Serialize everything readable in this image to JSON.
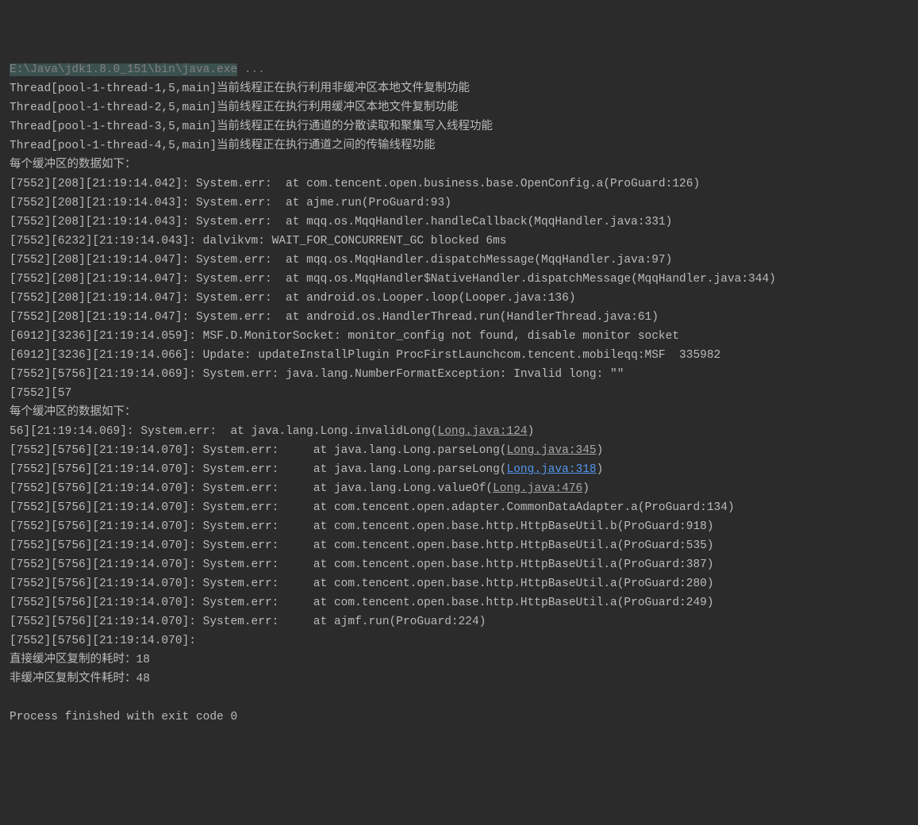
{
  "header": {
    "prefix": "E:\\Java\\jdk1.8.0_151\\bin\\java.exe",
    "suffix": " ..."
  },
  "threads": [
    {
      "prefix": "Thread[pool-1-thread-1,5,main]",
      "text": "当前线程正在执行利用非缓冲区本地文件复制功能"
    },
    {
      "prefix": "Thread[pool-1-thread-2,5,main]",
      "text": "当前线程正在执行利用缓冲区本地文件复制功能"
    },
    {
      "prefix": "Thread[pool-1-thread-3,5,main]",
      "text": "当前线程正在执行通道的分散读取和聚集写入线程功能"
    },
    {
      "prefix": "Thread[pool-1-thread-4,5,main]",
      "text": "当前线程正在执行通道之间的传输线程功能"
    }
  ],
  "buffer_header1": "每个缓冲区的数据如下：",
  "lines1": [
    "[7552][208][21:19:14.042]: System.err:  at com.tencent.open.business.base.OpenConfig.a(ProGuard:126)",
    "[7552][208][21:19:14.043]: System.err:  at ajme.run(ProGuard:93)",
    "[7552][208][21:19:14.043]: System.err:  at mqq.os.MqqHandler.handleCallback(MqqHandler.java:331)",
    "[7552][6232][21:19:14.043]: dalvikvm: WAIT_FOR_CONCURRENT_GC blocked 6ms",
    "[7552][208][21:19:14.047]: System.err:  at mqq.os.MqqHandler.dispatchMessage(MqqHandler.java:97)",
    "[7552][208][21:19:14.047]: System.err:  at mqq.os.MqqHandler$NativeHandler.dispatchMessage(MqqHandler.java:344)",
    "[7552][208][21:19:14.047]: System.err:  at android.os.Looper.loop(Looper.java:136)",
    "[7552][208][21:19:14.047]: System.err:  at android.os.HandlerThread.run(HandlerThread.java:61)",
    "[6912][3236][21:19:14.059]: MSF.D.MonitorSocket: monitor_config not found, disable monitor socket",
    "[6912][3236][21:19:14.066]: Update: updateInstallPlugin ProcFirstLaunchcom.tencent.mobileqq:MSF  335982",
    "[7552][5756][21:19:14.069]: System.err: java.lang.NumberFormatException: Invalid long: \"\"",
    "[7552][57"
  ],
  "buffer_header2": "每个缓冲区的数据如下：",
  "link_line1": {
    "prefix": "56][21:19:14.069]: System.err:  at java.lang.Long.invalidLong(",
    "link": "Long.java:124",
    "suffix": ")"
  },
  "link_line2": {
    "prefix": "[7552][5756][21:19:14.070]: System.err:     at java.lang.Long.parseLong(",
    "link": "Long.java:345",
    "suffix": ")"
  },
  "link_line3": {
    "prefix": "[7552][5756][21:19:14.070]: System.err:     at java.lang.Long.parseLong(",
    "link": "Long.java:318",
    "suffix": ")"
  },
  "link_line4": {
    "prefix": "[7552][5756][21:19:14.070]: System.err:     at java.lang.Long.valueOf(",
    "link": "Long.java:476",
    "suffix": ")"
  },
  "lines2": [
    "[7552][5756][21:19:14.070]: System.err:     at com.tencent.open.adapter.CommonDataAdapter.a(ProGuard:134)",
    "[7552][5756][21:19:14.070]: System.err:     at com.tencent.open.base.http.HttpBaseUtil.b(ProGuard:918)",
    "[7552][5756][21:19:14.070]: System.err:     at com.tencent.open.base.http.HttpBaseUtil.a(ProGuard:535)",
    "[7552][5756][21:19:14.070]: System.err:     at com.tencent.open.base.http.HttpBaseUtil.a(ProGuard:387)",
    "[7552][5756][21:19:14.070]: System.err:     at com.tencent.open.base.http.HttpBaseUtil.a(ProGuard:280)",
    "[7552][5756][21:19:14.070]: System.err:     at com.tencent.open.base.http.HttpBaseUtil.a(ProGuard:249)",
    "[7552][5756][21:19:14.070]: System.err:     at ajmf.run(ProGuard:224)",
    "[7552][5756][21:19:14.070]:"
  ],
  "summary1": "直接缓冲区复制的耗时：18",
  "summary2": "非缓冲区复制文件耗时：48",
  "exit_line": "Process finished with exit code 0"
}
